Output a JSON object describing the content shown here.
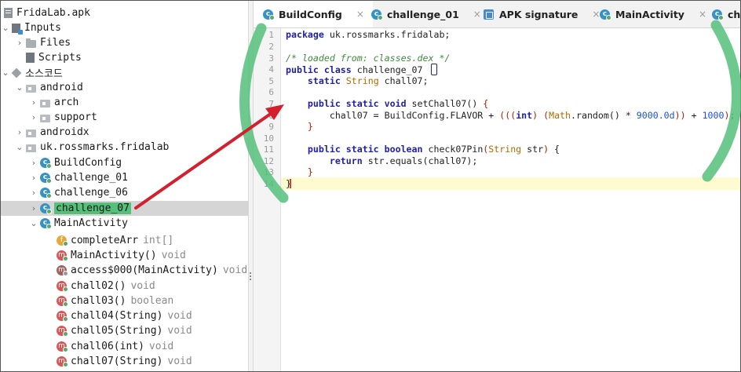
{
  "tree": {
    "root": "FridaLab.apk",
    "inputs": "Inputs",
    "files": "Files",
    "scripts": "Scripts",
    "source_code": "소스코드",
    "android": "android",
    "arch": "arch",
    "support": "support",
    "androidx": "androidx",
    "package": "uk.rossmarks.fridalab",
    "classes": [
      "BuildConfig",
      "challenge_01",
      "challenge_06",
      "challenge_07",
      "MainActivity"
    ],
    "members": [
      {
        "icon": "f",
        "name": "completeArr",
        "type": "int[]"
      },
      {
        "icon": "m",
        "name": "MainActivity()",
        "type": "void"
      },
      {
        "icon": "m",
        "name": "access$000(MainActivity)",
        "type": "void"
      },
      {
        "icon": "m",
        "name": "chall02()",
        "type": "void"
      },
      {
        "icon": "m",
        "name": "chall03()",
        "type": "boolean"
      },
      {
        "icon": "m",
        "name": "chall04(String)",
        "type": "void"
      },
      {
        "icon": "m",
        "name": "chall05(String)",
        "type": "void"
      },
      {
        "icon": "m",
        "name": "chall06(int)",
        "type": "void"
      },
      {
        "icon": "m",
        "name": "chall07(String)",
        "type": "void"
      }
    ]
  },
  "tabs": [
    {
      "label": "BuildConfig"
    },
    {
      "label": "challenge_01"
    },
    {
      "label": "APK signature"
    },
    {
      "label": "MainActivity"
    },
    {
      "label": "cha"
    }
  ],
  "tab_close": "×",
  "editor": {
    "line_numbers": [
      "1",
      "2",
      "3",
      "4",
      "5",
      "6",
      "7",
      "8",
      "9",
      "10",
      "11",
      "12",
      "13",
      "14"
    ],
    "l1_kw": "package",
    "l1_rest": " uk.rossmarks.fridalab;",
    "l3_comment": "/* loaded from: classes.dex */",
    "l4_kw": "public class",
    "l4_rest": " challenge_07 ",
    "l5_kw": "static",
    "l5_type": " String",
    "l5_rest": " chall07;",
    "l7_kw": "public static void",
    "l7_rest": " setChall07() ",
    "l7_brace": "{",
    "l8_a": "chall07 = BuildConfig.FLAVOR + ",
    "l8_p": "(((",
    "l8_int": "int",
    "l8_p2": ") (",
    "l8_math": "Math",
    "l8_b": ".random() * ",
    "l8_n1": "9000.0d",
    "l8_p3": "))",
    "l8_c": " + ",
    "l8_n2": "1000",
    "l8_p4": ")",
    "l8_end": ";",
    "l9_brace": "}",
    "l11_kw": "public static boolean",
    "l11_rest": " check07Pin",
    "l11_p": "(",
    "l11_type": "String",
    "l11_arg": " str",
    "l11_p2": ")",
    "l11_brace": " {",
    "l12_kw": "return",
    "l12_rest": " str.equals(chall07);",
    "l13_brace": "}",
    "l14_brace": "}"
  },
  "colors": {
    "highlight_green": "#54c07a",
    "arrow_red": "#d3202f",
    "keyword": "#1f1fa8"
  }
}
